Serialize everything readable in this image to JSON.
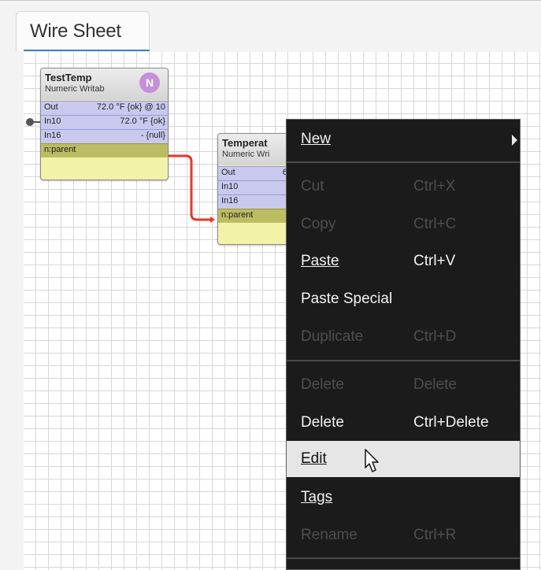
{
  "tab": {
    "title": "Wire Sheet"
  },
  "components": {
    "testtemp": {
      "title": "TestTemp",
      "subtitle": "Numeric Writab",
      "badge": "N",
      "slots": [
        {
          "name": "Out",
          "value": "72.0 °F {ok} @ 10"
        },
        {
          "name": "In10",
          "value": "72.0 °F {ok}"
        },
        {
          "name": "In16",
          "value": "- {null}"
        },
        {
          "name": "n:parent",
          "value": ""
        }
      ]
    },
    "temperature": {
      "title": "Temperat",
      "subtitle": "Numeric Wri",
      "slots": [
        {
          "name": "Out",
          "value": "6"
        },
        {
          "name": "In10",
          "value": ""
        },
        {
          "name": "In16",
          "value": ""
        },
        {
          "name": "n:parent",
          "value": ""
        }
      ]
    }
  },
  "context_menu": {
    "new": {
      "label": "New",
      "icon": "chevron-right-icon"
    },
    "cut": {
      "label": "Cut",
      "accelerator": "Ctrl+X",
      "enabled": false
    },
    "copy": {
      "label": "Copy",
      "accelerator": "Ctrl+C",
      "enabled": false
    },
    "paste": {
      "label": "Paste",
      "accelerator": "Ctrl+V",
      "enabled": true
    },
    "paste_special": {
      "label": "Paste Special",
      "accelerator": "",
      "enabled": true
    },
    "duplicate": {
      "label": "Duplicate",
      "accelerator": "Ctrl+D",
      "enabled": false
    },
    "delete_disabled": {
      "label": "Delete",
      "accelerator": "Delete",
      "enabled": false
    },
    "delete": {
      "label": "Delete",
      "accelerator": "Ctrl+Delete",
      "enabled": true
    },
    "edit": {
      "label": "Edit",
      "enabled": true,
      "highlighted": true
    },
    "tags": {
      "label": "Tags",
      "enabled": true
    },
    "rename": {
      "label": "Rename",
      "accelerator": "Ctrl+R",
      "enabled": false
    }
  },
  "colors": {
    "link_wire": "#e8352b",
    "menu_background": "#1b1b1b",
    "slot_background": "#c9c9f0",
    "parent_slot": "#bcbd62",
    "tab_accent": "#3a7fc7"
  }
}
